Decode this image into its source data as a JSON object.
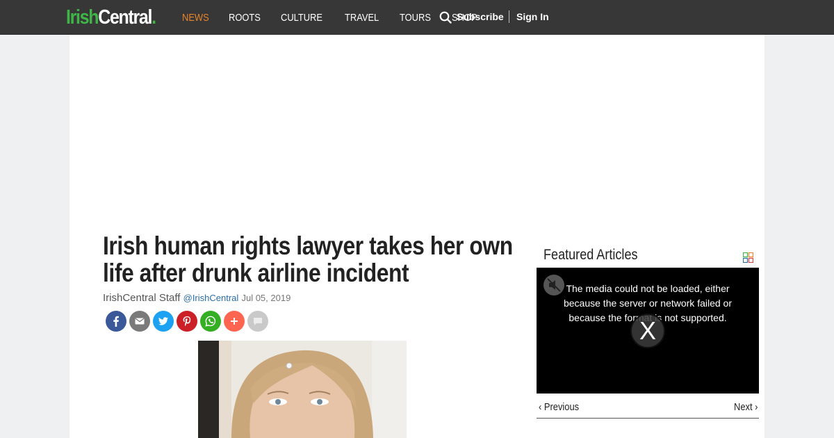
{
  "header": {
    "logo": {
      "part1": "Irish",
      "part2": "Central",
      "dot": "."
    },
    "nav": [
      "NEWS",
      "ROOTS",
      "CULTURE",
      "TRAVEL",
      "TOURS",
      "SHOP"
    ],
    "active_nav": "NEWS",
    "subscribe": "Subscribe",
    "signin": "Sign In",
    "colors": {
      "bar": "#373737",
      "active": "#e8842c",
      "brand_green": "#3fb548"
    }
  },
  "article": {
    "headline": "Irish human rights lawyer takes her own life after drunk airline incident",
    "author": "IrishCentral Staff",
    "handle": "@IrishCentral",
    "date": "Jul 05, 2019",
    "share_icons": [
      "facebook-icon",
      "email-icon",
      "twitter-icon",
      "pinterest-icon",
      "whatsapp-icon",
      "plus-icon",
      "comment-icon"
    ]
  },
  "sidebar": {
    "featured_title": "Featured Articles",
    "video_message": "The media could not be loaded, either because the server or network failed or because the format is not supported.",
    "close_label": "X",
    "prev_label": "‹ Previous",
    "next_label": "Next ›"
  }
}
